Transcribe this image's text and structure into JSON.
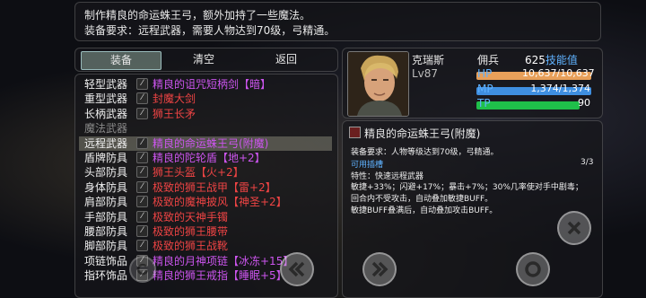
{
  "description": {
    "line1": "制作精良的命运蛛王弓，额外加持了一些魔法。",
    "line2": "装备要求：远程武器，需要人物达到70级，弓精通。"
  },
  "tabs": {
    "equip": "装备",
    "clear": "清空",
    "back": "返回"
  },
  "equipment": [
    {
      "slot": "轻型武器",
      "item": "精良的诅咒短柄剑【暗】",
      "item_color": "#cc55ee",
      "slot_color": "white"
    },
    {
      "slot": "重型武器",
      "item": "封魔大剑",
      "item_color": "#ee4444",
      "slot_color": "white"
    },
    {
      "slot": "长柄武器",
      "item": "狮王长矛",
      "item_color": "#ee4444",
      "slot_color": "white"
    },
    {
      "slot": "魔法武器",
      "item": "",
      "item_color": "#ffffff",
      "slot_color": "gray"
    },
    {
      "slot": "远程武器",
      "item": "精良的命运蛛王弓(附魔)",
      "item_color": "#cc55ee",
      "slot_color": "white",
      "selected": true
    },
    {
      "slot": "盾牌防具",
      "item": "精良的陀轮盾【地+2】",
      "item_color": "#cc55ee",
      "slot_color": "white"
    },
    {
      "slot": "头部防具",
      "item": "狮王头盔【火+2】",
      "item_color": "#ee4444",
      "slot_color": "white"
    },
    {
      "slot": "身体防具",
      "item": "极致的狮王战甲【雷+2】",
      "item_color": "#ee4444",
      "slot_color": "white"
    },
    {
      "slot": "肩部防具",
      "item": "极致的魔神披风【神圣+2】",
      "item_color": "#ee4444",
      "slot_color": "white"
    },
    {
      "slot": "手部防具",
      "item": "极致的天神手镯",
      "item_color": "#ee4444",
      "slot_color": "white"
    },
    {
      "slot": "腰部防具",
      "item": "极致的狮王腰带",
      "item_color": "#ee4444",
      "slot_color": "white"
    },
    {
      "slot": "脚部防具",
      "item": "极致的狮王战靴",
      "item_color": "#ee4444",
      "slot_color": "white"
    },
    {
      "slot": "项链饰品",
      "item": "精良的月神项链【冰冻+15】",
      "item_color": "#cc55ee",
      "slot_color": "white"
    },
    {
      "slot": "指环饰品",
      "item": "精良的狮王戒指【睡眠+5】",
      "item_color": "#cc55ee",
      "slot_color": "white"
    }
  ],
  "character": {
    "name": "克瑞斯",
    "class": "佣兵",
    "level": "Lv87",
    "skill_points_label": "625技能值",
    "hp_label": "HP",
    "hp_value": "10,637/10,637",
    "hp_fraction": 1.0,
    "mp_label": "MP",
    "mp_value": "1,374/1,374",
    "mp_fraction": 1.0,
    "tp_label": "TP",
    "tp_value": "90",
    "tp_fraction": 0.9
  },
  "item_detail": {
    "name": "精良的命运蛛王弓(附魔)",
    "requirement": "装备要求：人物等级达到70级，弓精通。",
    "usable": "可用插槽",
    "slots": "3/3",
    "trait": "特性：快速远程武器",
    "stats1": "敏捷+33%；闪避+17%；暴击+7%；30%几率使对手中剧毒；",
    "stats2": "回合内不受攻击，自动叠加敏捷BUFF。",
    "stats3": "敏捷BUFF叠满后，自动叠加攻击BUFF。"
  },
  "colors": {
    "hp": "#e8a05a",
    "mp": "#3f8fe0",
    "tp": "#1fc04a",
    "skill_pts": "#5fb2ff"
  }
}
